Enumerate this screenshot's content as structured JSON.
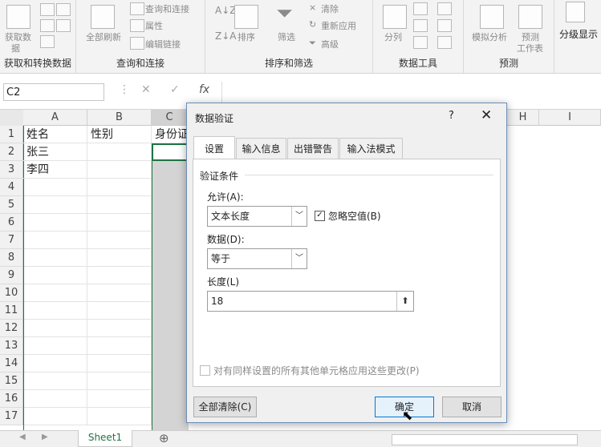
{
  "ribbon": {
    "groups": [
      {
        "label": "获取和转换数据",
        "items": [
          "获取数",
          "据"
        ]
      },
      {
        "label": "查询和连接",
        "items": [
          "全部刷新",
          "查询和连接",
          "属性",
          "编辑链接"
        ]
      },
      {
        "label": "排序和筛选",
        "items": [
          "排序",
          "筛选",
          "清除",
          "重新应用",
          "高级"
        ]
      },
      {
        "label": "数据工具",
        "items": [
          "分列"
        ]
      },
      {
        "label": "预测",
        "items": [
          "模拟分析",
          "预测",
          "工作表"
        ]
      },
      {
        "label": "",
        "items": [
          "分级显示"
        ]
      }
    ]
  },
  "formula_bar": {
    "name_box": "C2",
    "cancel": "✕",
    "enter": "✓",
    "fx": "fx",
    "value": ""
  },
  "sheet": {
    "columns": [
      "A",
      "B",
      "C",
      "H",
      "I"
    ],
    "rows": [
      "1",
      "2",
      "3",
      "4",
      "5",
      "6",
      "7",
      "8",
      "9",
      "10",
      "11",
      "12",
      "13",
      "14",
      "15",
      "16",
      "17"
    ],
    "cells": {
      "A1": "姓名",
      "B1": "性别",
      "C1": "身份证",
      "A2": "张三",
      "A3": "李四"
    },
    "tab": "Sheet1",
    "add_sheet": "⊕"
  },
  "dialog": {
    "title": "数据验证",
    "help": "?",
    "close": "✕",
    "tabs": [
      "设置",
      "输入信息",
      "出错警告",
      "输入法模式"
    ],
    "section_title": "验证条件",
    "allow_label": "允许(A):",
    "allow_value": "文本长度",
    "ignore_blank_label": "忽略空值(B)",
    "ignore_blank_checked": true,
    "data_label": "数据(D):",
    "data_value": "等于",
    "length_label": "长度(L)",
    "length_value": "18",
    "apply_all_label": "对有同样设置的所有其他单元格应用这些更改(P)",
    "clear_all": "全部清除(C)",
    "ok": "确定",
    "cancel": "取消"
  }
}
